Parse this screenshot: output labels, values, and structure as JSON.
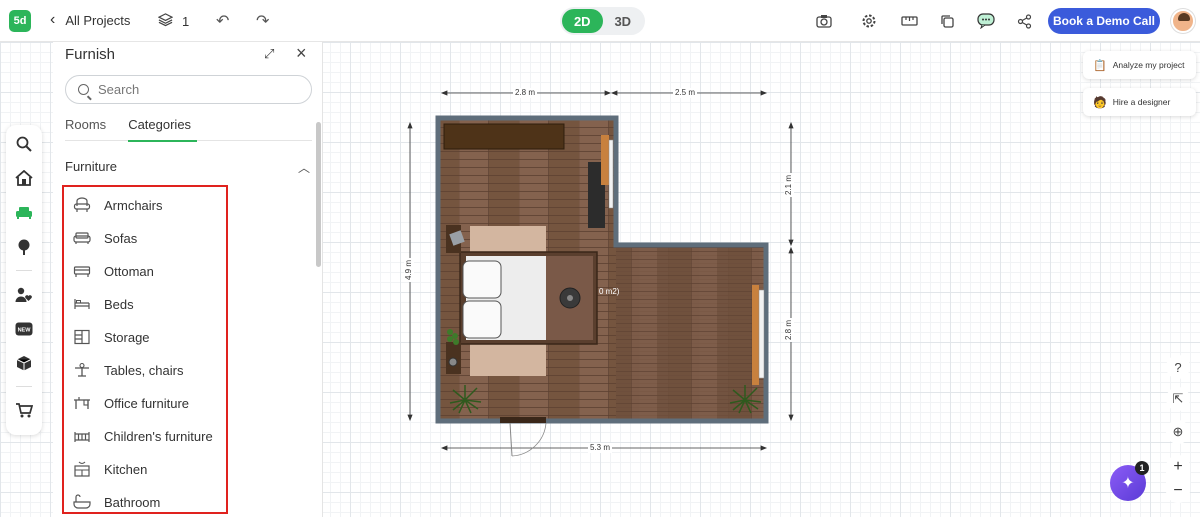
{
  "app": {
    "logo_text": "5d"
  },
  "header": {
    "back_label": "All Projects",
    "level_count": "1",
    "view_toggle": {
      "option_2d": "2D",
      "option_3d": "3D",
      "active": "2D"
    },
    "demo_button": "Book a Demo Call",
    "icons": [
      "camera-icon",
      "settings-icon",
      "ruler-icon",
      "copy-icon",
      "chat-icon",
      "share-icon"
    ]
  },
  "panel": {
    "title": "Furnish",
    "search_placeholder": "Search",
    "tabs": [
      "Rooms",
      "Categories"
    ],
    "active_tab": "Categories",
    "section_title": "Furniture",
    "items": [
      {
        "label": "Armchairs",
        "icon": "armchair-icon"
      },
      {
        "label": "Sofas",
        "icon": "sofa-icon"
      },
      {
        "label": "Ottoman",
        "icon": "ottoman-icon"
      },
      {
        "label": "Beds",
        "icon": "bed-icon"
      },
      {
        "label": "Storage",
        "icon": "storage-icon"
      },
      {
        "label": "Tables, chairs",
        "icon": "table-icon"
      },
      {
        "label": "Office furniture",
        "icon": "office-desk-icon"
      },
      {
        "label": "Children's furniture",
        "icon": "crib-icon"
      },
      {
        "label": "Kitchen",
        "icon": "kitchen-icon"
      },
      {
        "label": "Bathroom",
        "icon": "bathtub-icon"
      }
    ]
  },
  "toolbar_left": [
    "search-icon",
    "home-icon",
    "furniture-icon",
    "tree-icon",
    "user-heart-icon",
    "new-icon",
    "box-icon",
    "cart-icon"
  ],
  "plan": {
    "dimensions": {
      "top_left": "2.8 m",
      "top_right": "2.5 m",
      "left": "4.9 m",
      "right_top": "2.1 m",
      "right_bottom": "2.8 m",
      "bottom": "5.3 m"
    },
    "room_label": "0 m2)"
  },
  "right_panel": {
    "analyze": "Analyze my project",
    "hire": "Hire a designer",
    "ai_badge": "1"
  },
  "colors": {
    "accent": "#2cb55a",
    "demo": "#3b5bdb",
    "highlight": "#e0221e",
    "wall": "#5a6a78",
    "floor": "#7a5a48"
  }
}
